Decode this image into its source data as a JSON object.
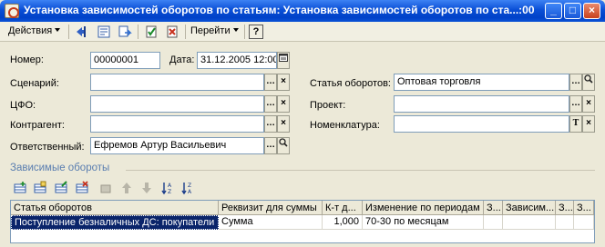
{
  "window": {
    "title": "Установка зависимостей оборотов по статьям: Установка зависимостей оборотов по ста...:00",
    "buttons": {
      "minimize": "_",
      "maximize": "□",
      "close": "×"
    }
  },
  "toolbar": {
    "actions_label": "Действия",
    "goto_label": "Перейти",
    "help_label": "?"
  },
  "form": {
    "number_label": "Номер:",
    "number_value": "00000001",
    "date_label": "Дата:",
    "date_value": "31.12.2005 12:00",
    "scenario_label": "Сценарий:",
    "scenario_value": "",
    "cfo_label": "ЦФО:",
    "cfo_value": "",
    "counterparty_label": "Контрагент:",
    "counterparty_value": "",
    "responsible_label": "Ответственный:",
    "responsible_value": "Ефремов Артур Васильевич",
    "turnover_item_label": "Статья оборотов:",
    "turnover_item_value": "Оптовая торговля",
    "project_label": "Проект:",
    "project_value": "",
    "nomenclature_label": "Номенклатура:",
    "nomenclature_value": ""
  },
  "section": {
    "title": "Зависимые обороты"
  },
  "table": {
    "columns": [
      "Статья оборотов",
      "Реквизит для суммы",
      "К-т д...",
      "Изменение по периодам",
      "З...",
      "Зависим...",
      "З...",
      "З..."
    ],
    "rows": [
      [
        "Поступление безналичных ДС: покупатели",
        "Сумма",
        "1,000",
        "70-30 по месяцам",
        "",
        "",
        "",
        ""
      ]
    ]
  },
  "icons": {
    "select": "…",
    "clear": "×",
    "search": "search-icon",
    "calendar": "calendar-icon",
    "text": "T"
  }
}
